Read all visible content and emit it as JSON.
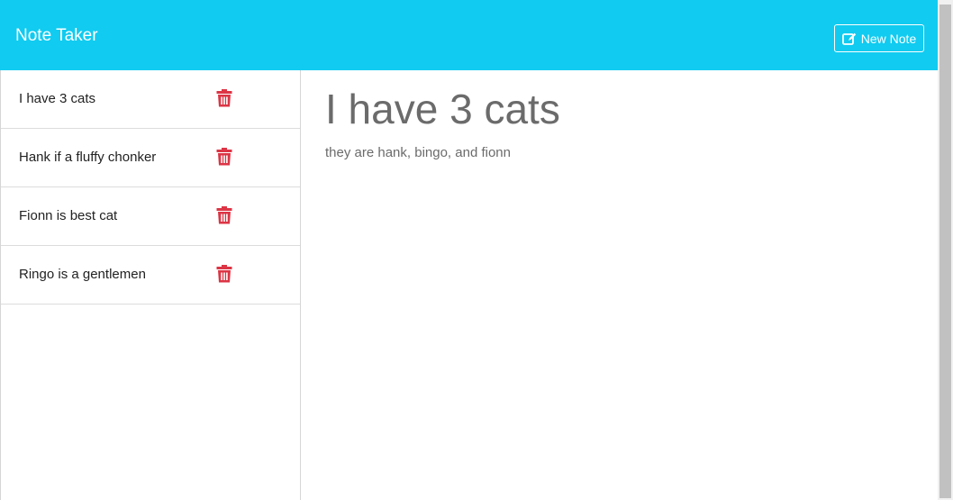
{
  "navbar": {
    "brand": "Note Taker",
    "new_note_label": "New Note"
  },
  "notes": [
    {
      "title": "I have 3 cats"
    },
    {
      "title": "Hank if a fluffy chonker"
    },
    {
      "title": "Fionn is best cat"
    },
    {
      "title": "Ringo is a gentlemen"
    }
  ],
  "active_note": {
    "title": "I have 3 cats",
    "text": "they are hank, bingo, and fionn"
  },
  "icons": {
    "delete": "trash-icon",
    "new_note": "edit-icon"
  },
  "colors": {
    "navbar": "#11cbf0",
    "delete": "#dc3545",
    "note_text": "#6b6b6b"
  }
}
